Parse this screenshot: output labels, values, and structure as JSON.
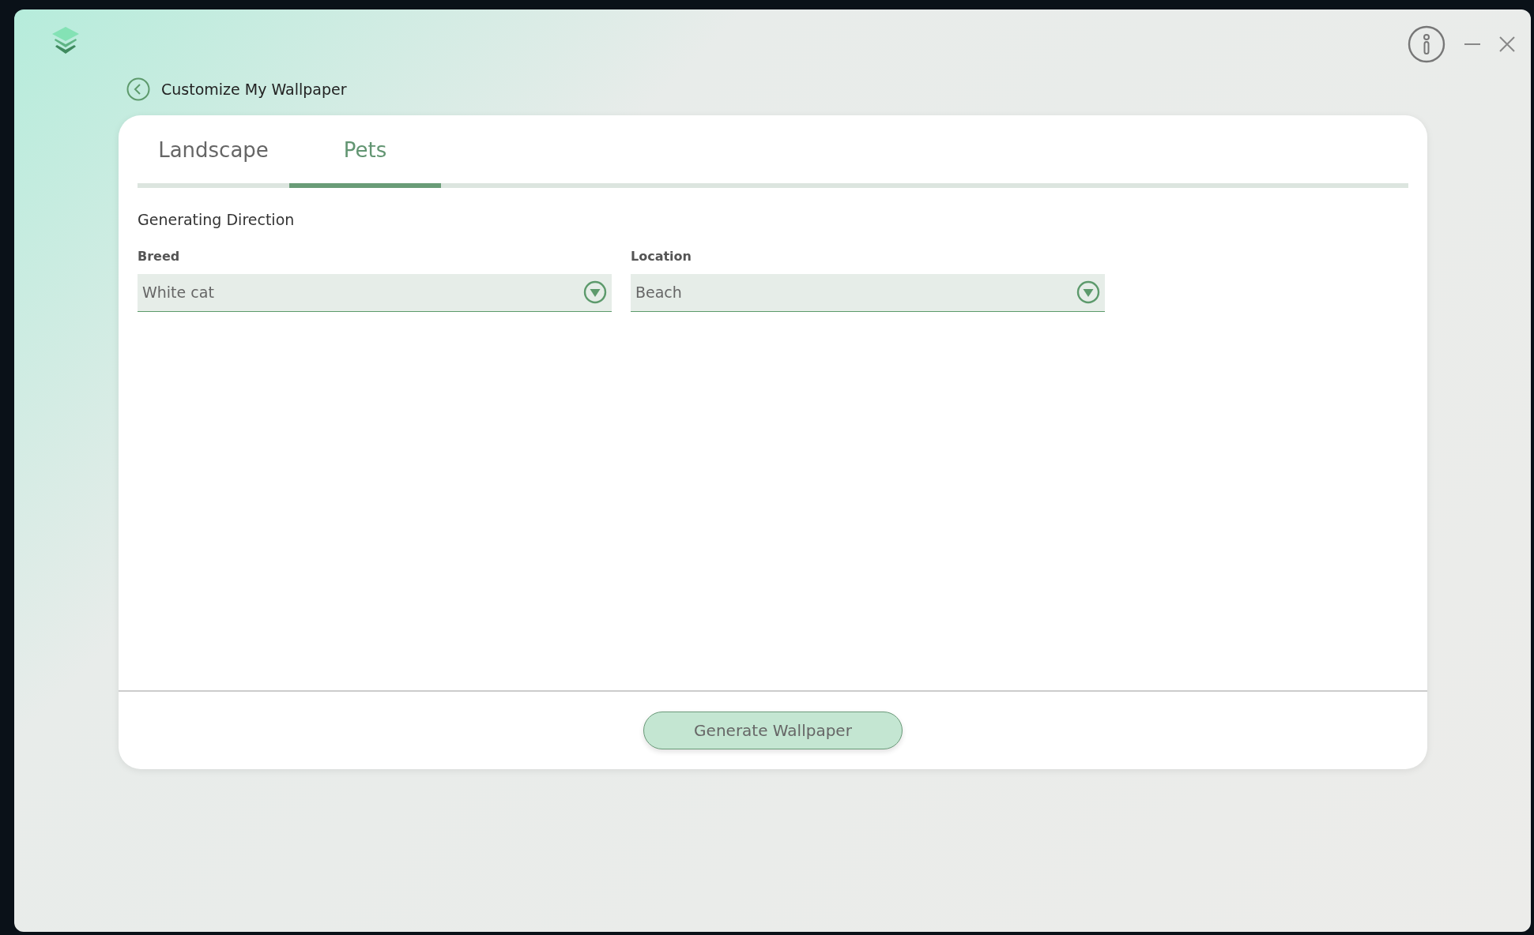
{
  "page_title": "Customize My Wallpaper",
  "tabs": [
    {
      "label": "Landscape",
      "selected": false
    },
    {
      "label": "Pets",
      "selected": true
    }
  ],
  "section_title": "Generating Direction",
  "fields": [
    {
      "label": "Breed",
      "value": "White cat"
    },
    {
      "label": "Location",
      "value": "Beach"
    }
  ],
  "primary_button": "Generate Wallpaper"
}
